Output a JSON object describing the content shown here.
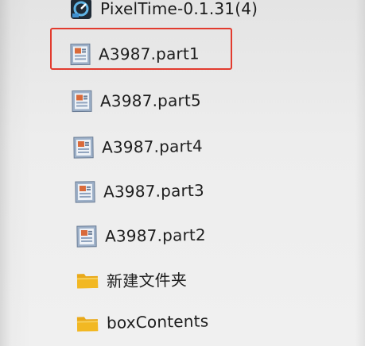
{
  "explorer": {
    "files": [
      {
        "name": "PixelTime-0.1.31(4)",
        "icon": "pixeltime-app-icon"
      },
      {
        "name": "A3987.part1",
        "icon": "archive-file-icon",
        "highlighted": true
      },
      {
        "name": "A3987.part5",
        "icon": "archive-file-icon"
      },
      {
        "name": "A3987.part4",
        "icon": "archive-file-icon"
      },
      {
        "name": "A3987.part3",
        "icon": "archive-file-icon"
      },
      {
        "name": "A3987.part2",
        "icon": "archive-file-icon"
      },
      {
        "name": "新建文件夹",
        "icon": "folder-icon"
      },
      {
        "name": "boxContents",
        "icon": "folder-icon"
      }
    ]
  },
  "colors": {
    "highlight_border": "#e23b2e",
    "folder": "#f2b823",
    "text": "#1d1d1d"
  }
}
